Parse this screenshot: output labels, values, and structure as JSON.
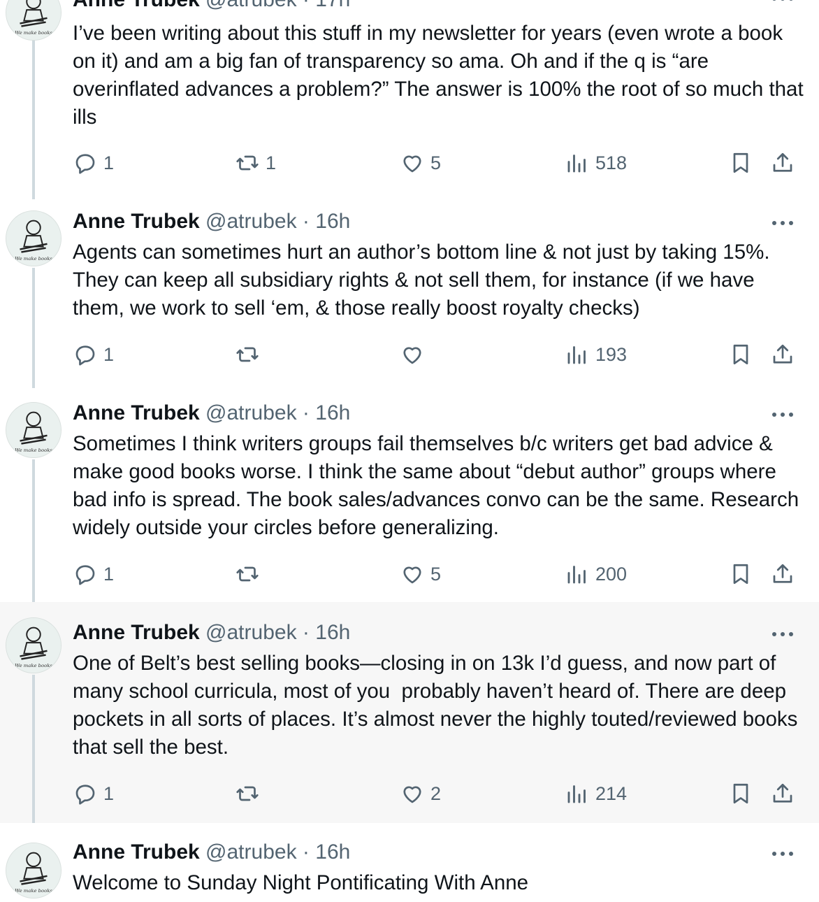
{
  "thread": [
    {
      "name": "Anne Trubek",
      "handle": "@atrubek",
      "separator": "·",
      "time": "17h",
      "text": "I’ve been writing about this stuff in my newsletter for years (even wrote a book on it) and am a big fan of transparency so ama. Oh and if the q is “are overinflated advances a problem?” The answer is 100% the root of so much that ills",
      "replies": "1",
      "reposts": "1",
      "likes": "5",
      "views": "518",
      "avatar_text": "We make books"
    },
    {
      "name": "Anne Trubek",
      "handle": "@atrubek",
      "separator": "·",
      "time": "16h",
      "text": "Agents can sometimes hurt an author’s bottom line & not just by taking 15%. They can keep all subsidiary rights & not sell them, for instance (if we have them, we work to sell ‘em, & those really boost royalty checks)",
      "replies": "1",
      "reposts": "",
      "likes": "",
      "views": "193",
      "avatar_text": "We make books"
    },
    {
      "name": "Anne Trubek",
      "handle": "@atrubek",
      "separator": "·",
      "time": "16h",
      "text": "Sometimes I think writers groups fail themselves b/c writers get bad advice & make good books worse. I think the same about “debut author” groups where bad info is spread. The book sales/advances convo can be the same. Research widely outside your circles before generalizing.",
      "replies": "1",
      "reposts": "",
      "likes": "5",
      "views": "200",
      "avatar_text": "We make books"
    },
    {
      "name": "Anne Trubek",
      "handle": "@atrubek",
      "separator": "·",
      "time": "16h",
      "text": "One of Belt’s best selling books—closing in on 13k I’d guess, and now part of many school curricula, most of you  probably haven’t heard of. There are deep pockets in all sorts of places. It’s almost never the highly touted/reviewed books that sell the best.",
      "replies": "1",
      "reposts": "",
      "likes": "2",
      "views": "214",
      "avatar_text": "We make books"
    },
    {
      "name": "Anne Trubek",
      "handle": "@atrubek",
      "separator": "·",
      "time": "16h",
      "text": "Welcome to Sunday Night Pontificating With Anne",
      "avatar_text": "We make books"
    }
  ],
  "icons": {
    "reply": "reply-icon",
    "repost": "repost-icon",
    "like": "heart-icon",
    "views": "views-icon",
    "bookmark": "bookmark-icon",
    "share": "share-icon",
    "more": "more-icon"
  },
  "colors": {
    "text": "#0f1419",
    "secondary": "#536471",
    "thread_line": "#cfd9de",
    "highlight_bg": "#f7f7f7"
  }
}
